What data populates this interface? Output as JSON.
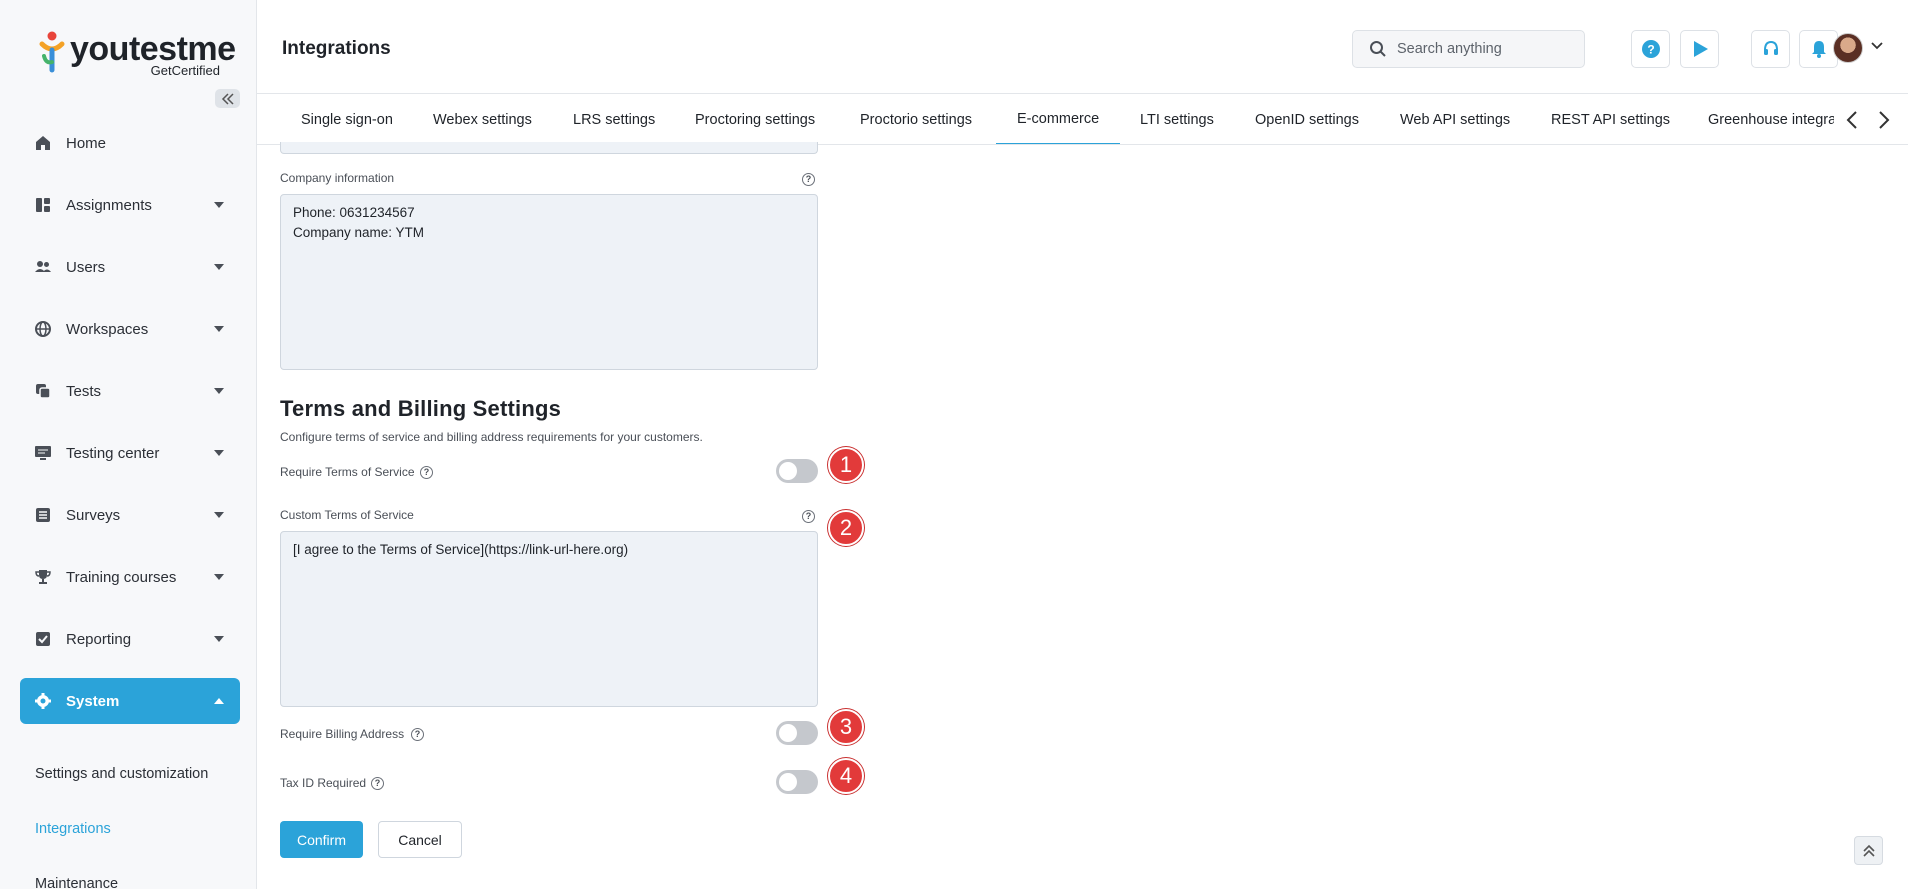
{
  "brand": {
    "name": "youtestme",
    "sub": "GetCertified"
  },
  "sidebar": {
    "items": [
      {
        "label": "Home",
        "icon": "home-icon"
      },
      {
        "label": "Assignments",
        "icon": "dashboard-icon"
      },
      {
        "label": "Users",
        "icon": "users-icon"
      },
      {
        "label": "Workspaces",
        "icon": "globe-icon"
      },
      {
        "label": "Tests",
        "icon": "copy-icon"
      },
      {
        "label": "Testing center",
        "icon": "monitor-icon"
      },
      {
        "label": "Surveys",
        "icon": "list-icon"
      },
      {
        "label": "Training courses",
        "icon": "trophy-icon"
      },
      {
        "label": "Reporting",
        "icon": "check-square-icon"
      },
      {
        "label": "System",
        "icon": "gear-icon"
      }
    ],
    "subitems": [
      {
        "label": "Settings and customization"
      },
      {
        "label": "Integrations"
      },
      {
        "label": "Maintenance"
      }
    ]
  },
  "header": {
    "title": "Integrations",
    "search_placeholder": "Search anything"
  },
  "tabs": [
    {
      "label": "Single sign-on"
    },
    {
      "label": "Webex settings"
    },
    {
      "label": "LRS settings"
    },
    {
      "label": "Proctoring settings"
    },
    {
      "label": "Proctorio settings"
    },
    {
      "label": "E-commerce"
    },
    {
      "label": "LTI settings"
    },
    {
      "label": "OpenID settings"
    },
    {
      "label": "Web API settings"
    },
    {
      "label": "REST API settings"
    },
    {
      "label": "Greenhouse integra"
    }
  ],
  "form": {
    "company_info": {
      "label": "Company information",
      "value": "Phone: 0631234567\nCompany name: YTM"
    },
    "section": {
      "title": "Terms and Billing Settings",
      "description": "Configure terms of service and billing address requirements for your customers."
    },
    "require_tos": {
      "label": "Require Terms of Service",
      "enabled": false
    },
    "custom_tos": {
      "label": "Custom Terms of Service",
      "value": "[I agree to the Terms of Service](https://link-url-here.org)"
    },
    "require_billing": {
      "label": "Require Billing Address",
      "enabled": false
    },
    "tax_id": {
      "label": "Tax ID Required",
      "enabled": false
    },
    "confirm_label": "Confirm",
    "cancel_label": "Cancel"
  },
  "badges": [
    "1",
    "2",
    "3",
    "4"
  ],
  "colors": {
    "accent": "#2ba3d9",
    "badge": "#e23a3a"
  }
}
